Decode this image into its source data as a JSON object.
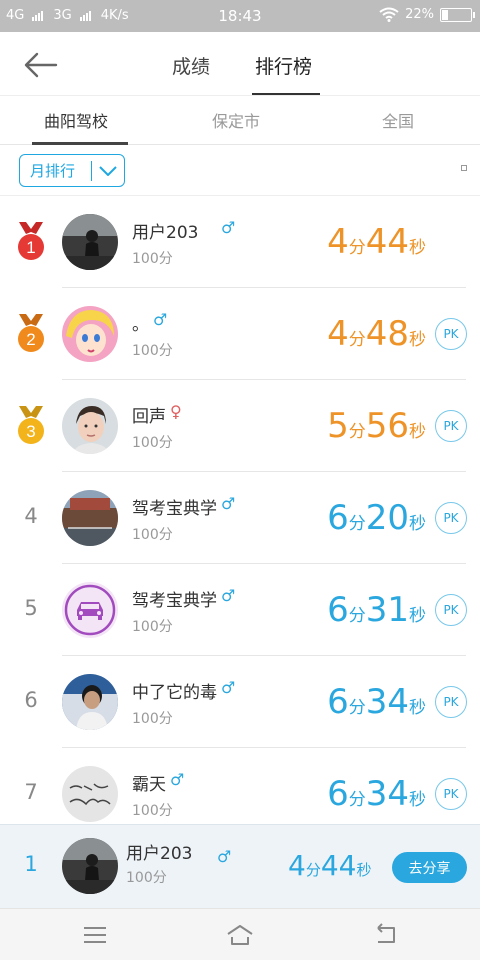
{
  "status_bar": {
    "network1": "4G",
    "network2": "3G",
    "speed": "4K/s",
    "time": "18:43",
    "battery": "22%",
    "battery_level": 0.22
  },
  "header": {
    "tabs": [
      "成绩",
      "排行榜"
    ],
    "active_tab": "排行榜"
  },
  "subtabs": {
    "items": [
      "曲阳驾校",
      "保定市",
      "全国"
    ],
    "active": "曲阳驾校"
  },
  "filter": {
    "label": "月排行"
  },
  "colors": {
    "accent": "#2aa7de",
    "gold_time": "#ee9327",
    "medal_red": "#e53935",
    "medal_orange": "#f08a1c",
    "medal_yellow": "#f3b31a"
  },
  "rankings": [
    {
      "rank": "1",
      "name": "用户203",
      "gender": "♂",
      "score": "100分",
      "min": "4",
      "min_unit": "分",
      "sec": "44",
      "sec_unit": "秒",
      "pk": ""
    },
    {
      "rank": "2",
      "name": "。",
      "gender": "♂",
      "score": "100分",
      "min": "4",
      "min_unit": "分",
      "sec": "48",
      "sec_unit": "秒",
      "pk": "PK"
    },
    {
      "rank": "3",
      "name": "回声",
      "gender": "♀",
      "score": "100分",
      "min": "5",
      "min_unit": "分",
      "sec": "56",
      "sec_unit": "秒",
      "pk": "PK"
    },
    {
      "rank": "4",
      "name": "驾考宝典学",
      "gender": "♂",
      "score": "100分",
      "min": "6",
      "min_unit": "分",
      "sec": "20",
      "sec_unit": "秒",
      "pk": "PK"
    },
    {
      "rank": "5",
      "name": "驾考宝典学",
      "gender": "♂",
      "score": "100分",
      "min": "6",
      "min_unit": "分",
      "sec": "31",
      "sec_unit": "秒",
      "pk": "PK"
    },
    {
      "rank": "6",
      "name": "中了它的毒",
      "gender": "♂",
      "score": "100分",
      "min": "6",
      "min_unit": "分",
      "sec": "34",
      "sec_unit": "秒",
      "pk": "PK"
    },
    {
      "rank": "7",
      "name": "霸天",
      "gender": "♂",
      "score": "100分",
      "min": "6",
      "min_unit": "分",
      "sec": "34",
      "sec_unit": "秒",
      "pk": "PK"
    }
  ],
  "own": {
    "rank": "1",
    "name": "用户203",
    "gender": "♂",
    "score": "100分",
    "min": "4",
    "min_unit": "分",
    "sec": "44",
    "sec_unit": "秒",
    "share_label": "去分享"
  },
  "navbar": {
    "icons": [
      "menu-icon",
      "home-icon",
      "back-icon"
    ]
  }
}
